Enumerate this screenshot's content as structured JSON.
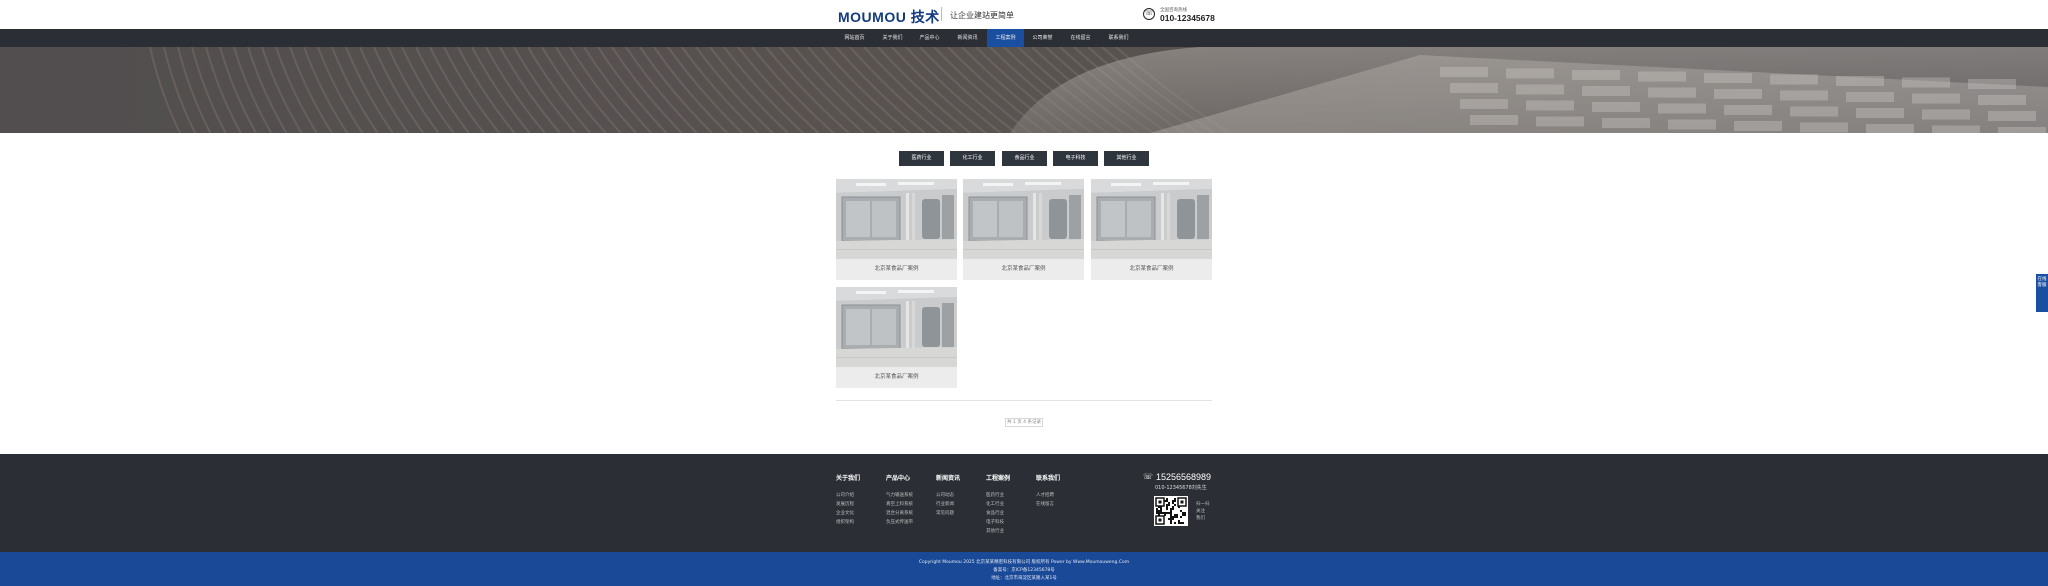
{
  "header": {
    "logo": "MOUMOU 技术",
    "slogan": "让企业建站更简单",
    "hotline_label": "全国咨询热线",
    "hotline_number": "010-12345678"
  },
  "nav": {
    "items": [
      "网站首页",
      "关于我们",
      "产品中心",
      "新闻资讯",
      "工程案例",
      "公司荣誉",
      "在线留言",
      "联系我们"
    ],
    "active_index": 4
  },
  "categories": [
    "医药行业",
    "化工行业",
    "食品行业",
    "电子科技",
    "其他行业"
  ],
  "cases": [
    {
      "caption": "北京某食品厂案例"
    },
    {
      "caption": "北京某食品厂案例"
    },
    {
      "caption": "北京某食品厂案例"
    },
    {
      "caption": "北京某食品厂案例"
    }
  ],
  "pager": {
    "label": "共 1 页 4 条记录"
  },
  "footer": {
    "columns": [
      {
        "title": "关于我们",
        "links": [
          "公司介绍",
          "发展历程",
          "企业文化",
          "组织架构"
        ]
      },
      {
        "title": "产品中心",
        "links": [
          "气力输送系统",
          "真空上料系统",
          "混合分离系统",
          "负压式传送带"
        ]
      },
      {
        "title": "新闻资讯",
        "links": [
          "公司动态",
          "行业新闻",
          "常见问题"
        ]
      },
      {
        "title": "工程案例",
        "links": [
          "医药行业",
          "化工行业",
          "食品行业",
          "电子科技",
          "其他行业"
        ]
      },
      {
        "title": "联系我们",
        "links": [
          "人才招聘",
          "在线留言"
        ]
      }
    ],
    "phone": "15256568989",
    "contact": "010-12345678刘先生",
    "qr_labels": [
      "扫一扫",
      "关注",
      "我们"
    ],
    "copyright_lines": [
      "Copyright Moumou 2025 北京某某精密科技有限公司 版权所有 Power by Www.Moumouweng.Com",
      "备案号：京ICP备12345678号",
      "地址：北京市海淀区某路入某1号"
    ]
  },
  "side_tab": {
    "label": "在线客服"
  },
  "colors": {
    "nav_bg": "#2b2f35",
    "accent_blue": "#1a4ea1",
    "bottom_bar": "#1a4a97"
  }
}
